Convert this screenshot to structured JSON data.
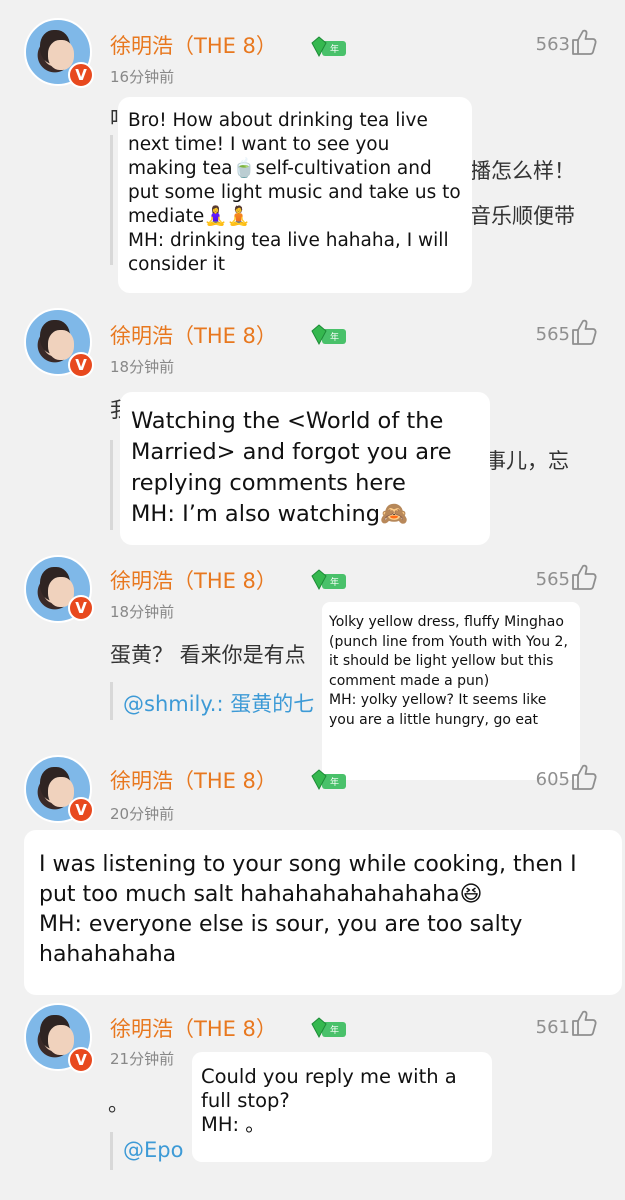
{
  "comments": [
    {
      "author": "徐明浩（THE 8）",
      "time": "16分钟前",
      "likes": "563",
      "bg_lines": [
        "播怎么样！",
        "音乐顺便带"
      ],
      "bg_prefix": "吗",
      "translation": "Bro! How about drinking tea live next time! I want to see you making tea🍵self-cultivation and put some light music and take us to mediate🧘‍♀️🧘",
      "reply": "MH: drinking tea live hahaha, I will consider it"
    },
    {
      "author": "徐明浩（THE 8）",
      "time": "18分钟前",
      "likes": "565",
      "bg_prefix": "我",
      "bg_lines": [
        "事儿，忘"
      ],
      "translation": "Watching the <World of the Married> and forgot you are replying comments here",
      "reply": "MH: I’m also watching🙈"
    },
    {
      "author": "徐明浩（THE 8）",
      "time": "18分钟前",
      "likes": "565",
      "bg_main": "蛋黄？ 看来你是有点",
      "quote": "@shmily.: 蛋黄的七",
      "translation": "Yolky yellow dress, fluffy Minghao (punch line from Youth with You 2, it should be light yellow but this comment made a pun)",
      "reply": "MH: yolky yellow? It seems like you are a little hungry, go eat"
    },
    {
      "author": "徐明浩（THE 8）",
      "time": "20分钟前",
      "likes": "605",
      "translation": "I was listening to your song while cooking, then I put too much salt hahahahahahahaha😆",
      "reply": "MH: everyone else is sour, you are too salty hahahahaha"
    },
    {
      "author": "徐明浩（THE 8）",
      "time": "21分钟前",
      "likes": "561",
      "bg_main": "。",
      "quote": "@Epo",
      "translation": "Could you reply me with a full stop?",
      "reply": "MH: 。"
    }
  ],
  "badge": {
    "verified": "V",
    "level_label": "年"
  },
  "colors": {
    "name": "#e8781f",
    "quote": "#3d9ad6",
    "badge": "#e8491e",
    "level": "#49c16a"
  },
  "icons": [
    "thumbs-up-icon",
    "verified-badge-icon",
    "level-gem-icon"
  ]
}
